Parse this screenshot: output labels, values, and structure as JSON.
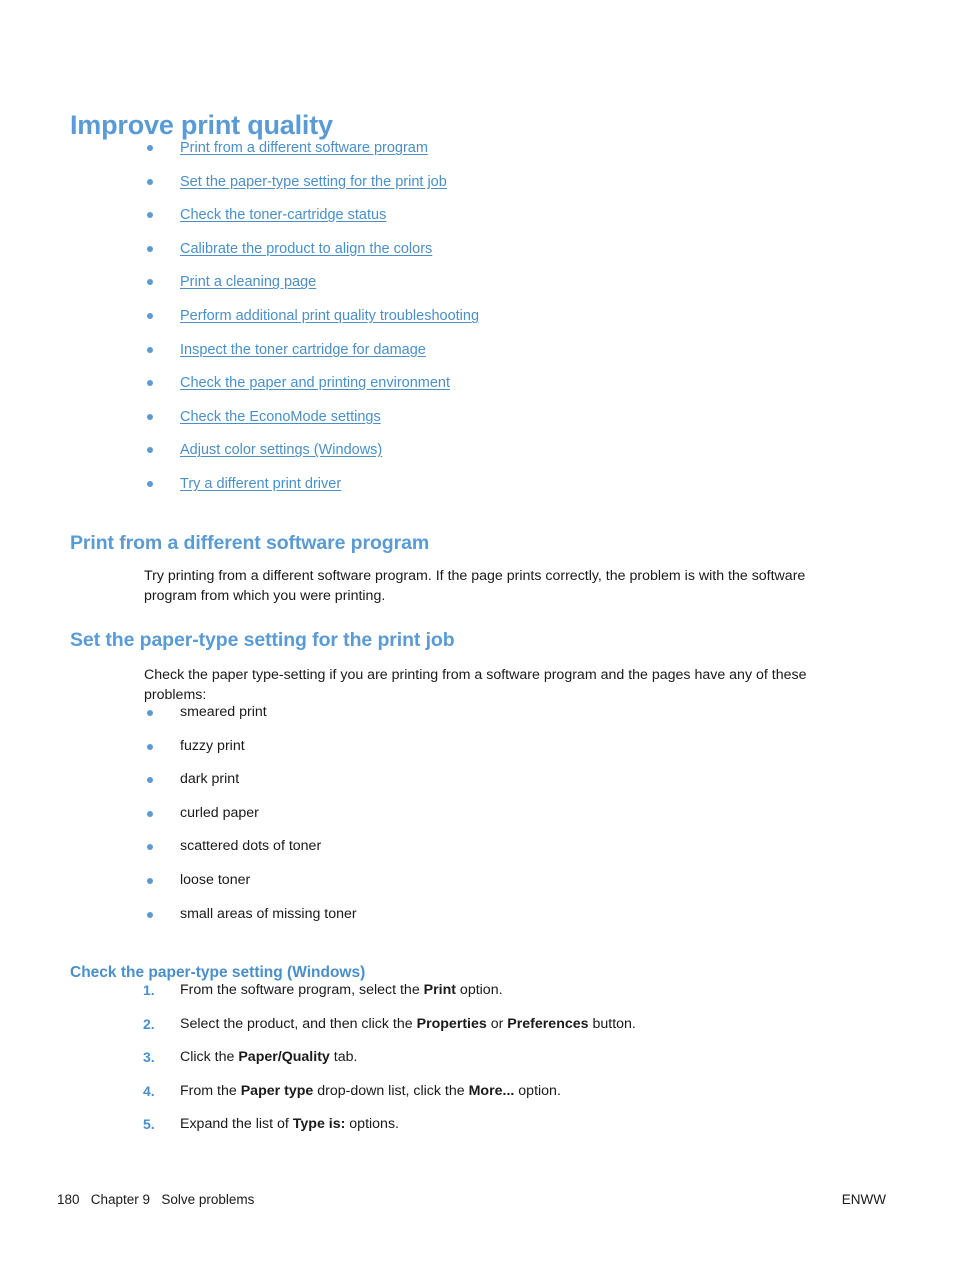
{
  "colors": {
    "heading_blue": "#5a9bd5",
    "link_blue": "#4a8fc9",
    "body_text": "#1a1a1a",
    "page_background": "#ffffff"
  },
  "page_title": "Improve print quality",
  "toc": {
    "links": [
      "Print from a different software program",
      "Set the paper-type setting for the print job",
      "Check the toner-cartridge status",
      "Calibrate the product to align the colors",
      "Print a cleaning page",
      "Perform additional print quality troubleshooting",
      "Inspect the toner cartridge for damage",
      "Check the paper and printing environment",
      "Check the EconoMode settings",
      "Adjust color settings (Windows)",
      "Try a different print driver"
    ]
  },
  "sections": {
    "print_from_different_program": {
      "heading": "Print from a different software program",
      "paragraph": "Try printing from a different software program. If the page prints correctly, the problem is with the software program from which you were printing."
    },
    "set_paper_type": {
      "heading": "Set the paper-type setting for the print job",
      "paragraph": "Check the paper type-setting if you are printing from a software program and the pages have any of these problems:",
      "problem_bullets": [
        "smeared print",
        "fuzzy print",
        "dark print",
        "curled paper",
        "scattered dots of toner",
        "loose toner",
        "small areas of missing toner"
      ],
      "subsection": {
        "heading": "Check the paper-type setting (Windows)",
        "steps": [
          {
            "num": "1.",
            "html": "From the software program, select the <b>Print</b> option."
          },
          {
            "num": "2.",
            "html": "Select the product, and then click the <b>Properties</b> or <b>Preferences</b> button."
          },
          {
            "num": "3.",
            "html": "Click the <b>Paper/Quality</b> tab."
          },
          {
            "num": "4.",
            "html": "From the <b>Paper type</b> drop-down list, click the <b>More...</b> option."
          },
          {
            "num": "5.",
            "html": "Expand the list of <b>Type is:</b> options."
          }
        ]
      }
    }
  },
  "footer": {
    "page_number": "180",
    "chapter": "Chapter 9",
    "chapter_title": "Solve problems",
    "left_text": "180   Chapter 9   Solve problems",
    "right_text": "ENWW"
  }
}
